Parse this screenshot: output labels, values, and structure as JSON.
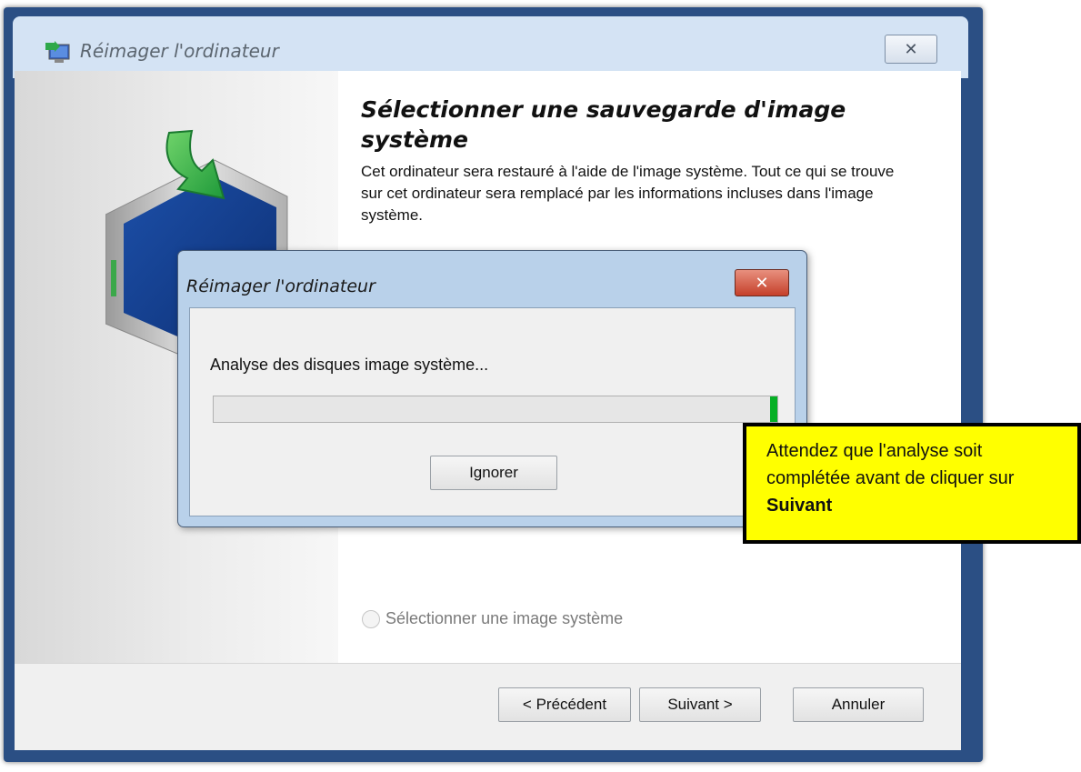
{
  "window": {
    "title": "Réimager l'ordinateur",
    "close_label": "✕"
  },
  "main": {
    "heading": "Sélectionner une sauvegarde d'image système",
    "description": "Cet ordinateur sera restauré à l'aide de l'image système. Tout ce qui se trouve sur cet ordinateur sera remplacé par les informations incluses dans l'image système.",
    "radio_label": "Sélectionner une image système"
  },
  "footer": {
    "previous_label": "< Précédent",
    "next_label": "Suivant >",
    "cancel_label": "Annuler"
  },
  "dialog": {
    "title": "Réimager l'ordinateur",
    "close_label": "✕",
    "status_text": "Analyse des disques image système...",
    "ignore_label": "Ignorer"
  },
  "callout": {
    "text_start": "Attendez que l'analyse soit complétée avant de cliquer sur ",
    "text_bold": "Suivant"
  },
  "colors": {
    "titlebar": "#d4e3f4",
    "frame": "#2b4f84",
    "callout_bg": "#ffff00",
    "progress_fill": "#06b025",
    "dialog_close": "#c5402a"
  },
  "icons": [
    "computer-restore-icon",
    "close-icon"
  ]
}
